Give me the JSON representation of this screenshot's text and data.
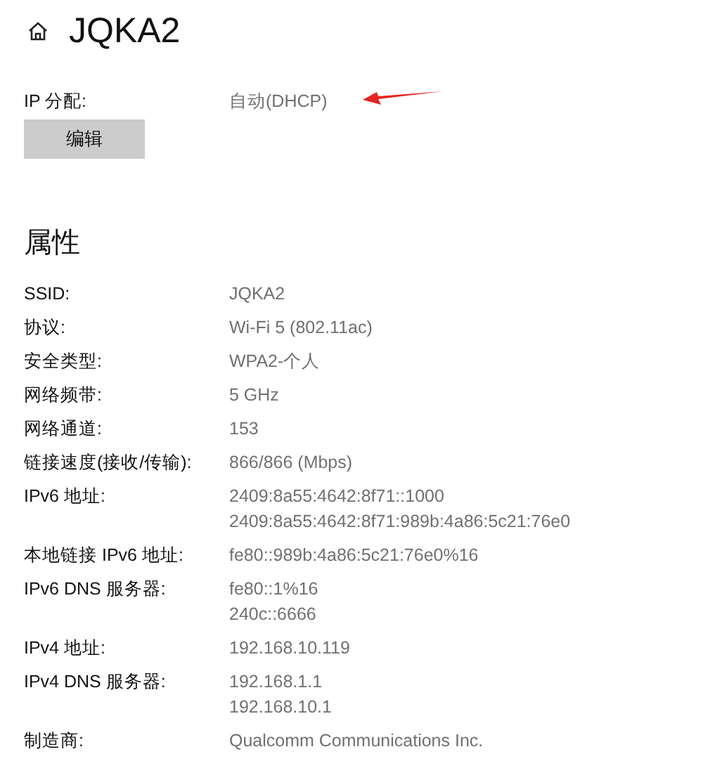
{
  "header": {
    "title": "JQKA2"
  },
  "ip_assignment": {
    "label": "IP 分配:",
    "value": "自动(DHCP)",
    "edit_button": "编辑"
  },
  "properties": {
    "heading": "属性",
    "rows": [
      {
        "label": "SSID:",
        "values": [
          "JQKA2"
        ]
      },
      {
        "label": "协议:",
        "values": [
          "Wi-Fi 5 (802.11ac)"
        ]
      },
      {
        "label": "安全类型:",
        "values": [
          "WPA2-个人"
        ]
      },
      {
        "label": "网络频带:",
        "values": [
          "5 GHz"
        ]
      },
      {
        "label": "网络通道:",
        "values": [
          "153"
        ]
      },
      {
        "label": "链接速度(接收/传输):",
        "values": [
          "866/866 (Mbps)"
        ]
      },
      {
        "label": "IPv6 地址:",
        "values": [
          "2409:8a55:4642:8f71::1000",
          "2409:8a55:4642:8f71:989b:4a86:5c21:76e0"
        ]
      },
      {
        "label": "本地链接 IPv6 地址:",
        "values": [
          "fe80::989b:4a86:5c21:76e0%16"
        ]
      },
      {
        "label": "IPv6 DNS 服务器:",
        "values": [
          "fe80::1%16",
          "240c::6666"
        ]
      },
      {
        "label": "IPv4 地址:",
        "values": [
          "192.168.10.119"
        ]
      },
      {
        "label": "IPv4 DNS 服务器:",
        "values": [
          "192.168.1.1",
          "192.168.10.1"
        ]
      },
      {
        "label": "制造商:",
        "values": [
          "Qualcomm Communications Inc."
        ]
      }
    ]
  }
}
